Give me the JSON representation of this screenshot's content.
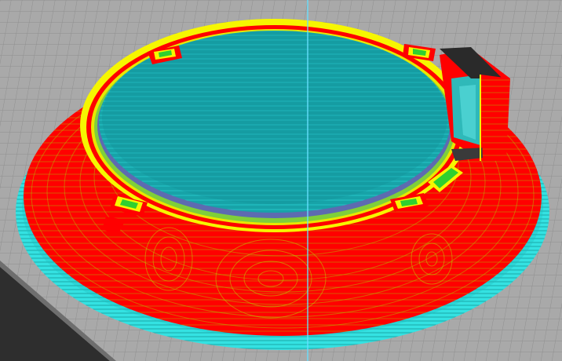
{
  "viewport": {
    "kind": "slicer-layer-preview",
    "model": "dome-ring-with-socket",
    "colors": {
      "build_plate": "#a9a9a9",
      "grid_line": "#8f8f8f",
      "plate_edge": "#2e2e2e",
      "infill": "#17a3a8",
      "infill_line": "#2cd3d8",
      "support": "#34e2e2",
      "outer_wall": "#ff0000",
      "inner_wall": "#f6f600",
      "skin": "#2fd02f",
      "axis_line": "#66e0ff"
    },
    "features": [
      "infill-disc",
      "outer-wall-shell",
      "inner-wall-rim",
      "support-skirt",
      "mount-tabs",
      "cable-socket"
    ]
  }
}
